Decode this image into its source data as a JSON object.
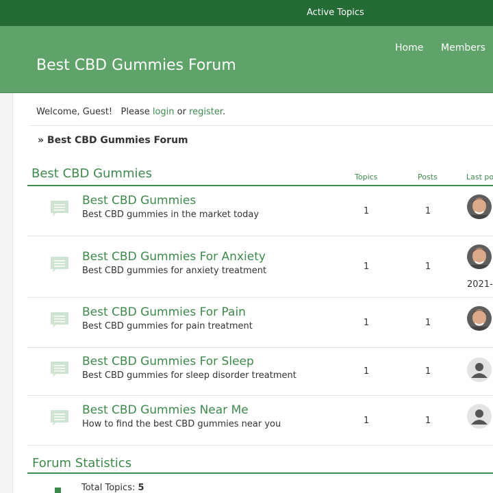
{
  "topbar": {
    "active_topics": "Active Topics"
  },
  "header": {
    "site_title": "Best CBD Gummies Forum",
    "nav": {
      "home": "Home",
      "members": "Members"
    }
  },
  "welcome": {
    "prefix": "Welcome, Guest!   Please ",
    "login": "login",
    "or": " or ",
    "register": "register",
    "suffix": "."
  },
  "breadcrumb": "» Best CBD Gummies Forum",
  "category": {
    "title": "Best CBD Gummies",
    "columns": {
      "topics": "Topics",
      "posts": "Posts",
      "last_post": "Last po"
    },
    "forums": [
      {
        "name": "Best CBD Gummies",
        "description": "Best CBD gummies in the market today",
        "topics": "1",
        "posts": "1",
        "avatar": "photo"
      },
      {
        "name": "Best CBD Gummies For Anxiety",
        "description": "Best CBD gummies for anxiety treatment",
        "topics": "1",
        "posts": "1",
        "avatar": "photo",
        "last_date": "2021-"
      },
      {
        "name": "Best CBD Gummies For Pain",
        "description": "Best CBD gummies for pain treatment",
        "topics": "1",
        "posts": "1",
        "avatar": "photo"
      },
      {
        "name": "Best CBD Gummies For Sleep",
        "description": "Best CBD gummies for sleep disorder treatment",
        "topics": "1",
        "posts": "1",
        "avatar": "default"
      },
      {
        "name": "Best CBD Gummies Near Me",
        "description": "How to find the best CBD gummies near you",
        "topics": "1",
        "posts": "1",
        "avatar": "default"
      }
    ]
  },
  "statistics": {
    "title": "Forum Statistics",
    "total_topics_label": "Total Topics: ",
    "total_topics_value": "5"
  },
  "icons": {
    "forum": "speech-bubble-icon",
    "avatar_default": "user-silhouette-icon"
  },
  "colors": {
    "topbar": "#256b35",
    "header": "#5fa26a",
    "accent": "#3d8a4c"
  }
}
